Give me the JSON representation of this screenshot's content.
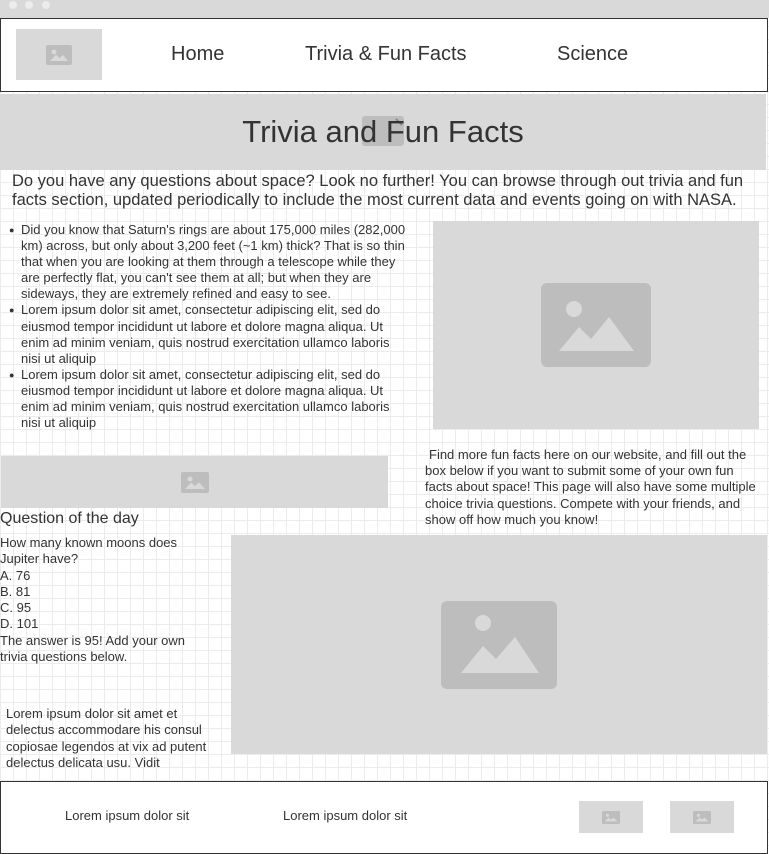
{
  "nav": {
    "logo_icon": "image-placeholder-icon",
    "links": [
      "Home",
      "Trivia & Fun Facts",
      "Science"
    ]
  },
  "hero": {
    "title": "Trivia and Fun Facts",
    "icon": "broken-image-icon"
  },
  "intro": "Do you have any questions about space? Look no further! You can browse through out trivia and fun facts section, updated periodically to include the most current data and events going on with NASA.",
  "facts": [
    "Did you know that Saturn's rings are about 175,000 miles (282,000 km) across, but only about 3,200 feet (~1 km) thick? That is so thin that when you are looking at them through a telescope while they are perfectly flat, you can't see them at all; but when they are sideways, they are extremely refined and easy to see.",
    "Lorem ipsum dolor sit amet, consectetur adipiscing elit, sed do eiusmod tempor incididunt ut labore et dolore magna aliqua. Ut enim ad minim veniam, quis nostrud exercitation ullamco laboris nisi ut aliquip",
    "Lorem ipsum dolor sit amet, consectetur adipiscing elit, sed do eiusmod tempor incididunt ut labore et dolore magna aliqua. Ut enim ad minim veniam, quis nostrud exercitation ullamco laboris nisi ut aliquip"
  ],
  "side_text": "Find more fun facts here on our website, and fill out the box below if you want to submit some of your own fun facts about space! This page will also have some multiple choice trivia questions. Compete with your friends, and show off how much you know!",
  "question": {
    "heading": "Question of the day",
    "text": "How many known moons does Jupiter have?",
    "options": [
      "A. 76",
      "B. 81",
      "C. 95",
      "D. 101"
    ],
    "answer": "The answer is 95! Add your own trivia questions below."
  },
  "lorem_paragraph": "Lorem ipsum dolor sit amet et delectus accommodare his consul copiosae legendos at vix ad putent delectus delicata usu. Vidit",
  "footer": {
    "links": [
      "Lorem ipsum dolor sit",
      "Lorem ipsum dolor sit"
    ],
    "icons": [
      "image-placeholder-icon",
      "image-placeholder-icon"
    ]
  },
  "colors": {
    "placeholder_bg": "#d9d9d9",
    "placeholder_icon": "#bdbdbd",
    "text": "#333333",
    "grid": "#ececec"
  }
}
